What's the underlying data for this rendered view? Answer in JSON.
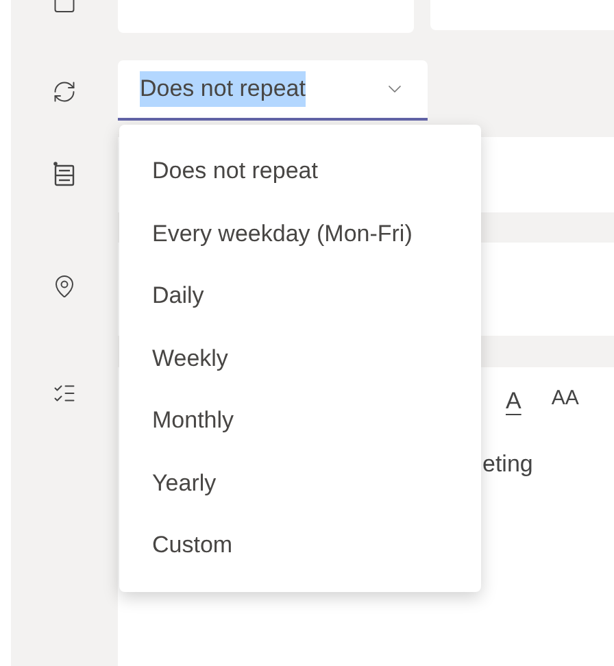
{
  "repeat_field": {
    "value": "Does not repeat",
    "focused": true
  },
  "repeat_menu": [
    {
      "label": "Does not repeat"
    },
    {
      "label": "Every weekday (Mon-Fri)"
    },
    {
      "label": "Daily"
    },
    {
      "label": "Weekly"
    },
    {
      "label": "Monthly"
    },
    {
      "label": "Yearly"
    },
    {
      "label": "Custom"
    }
  ],
  "toolbar": {
    "font_color": "A",
    "font_size": "AA"
  },
  "editor": {
    "text": "eting"
  }
}
